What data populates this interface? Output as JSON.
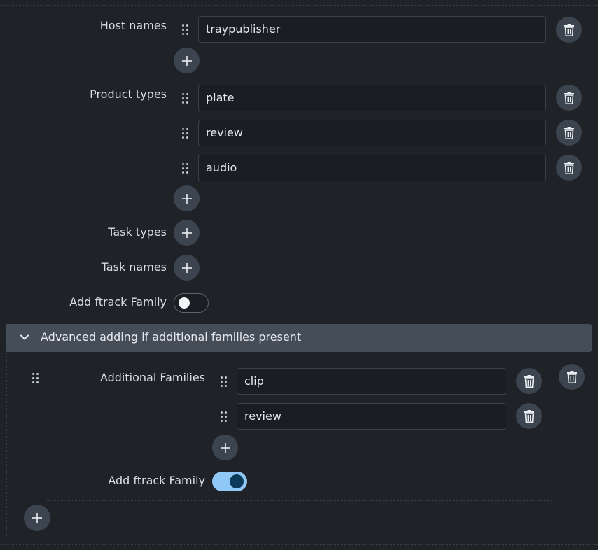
{
  "host_names": {
    "label": "Host names",
    "items": [
      "traypublisher"
    ]
  },
  "product_types": {
    "label": "Product types",
    "items": [
      "plate",
      "review",
      "audio"
    ]
  },
  "task_types": {
    "label": "Task types"
  },
  "task_names": {
    "label": "Task names"
  },
  "add_ftrack_family": {
    "label": "Add ftrack Family",
    "checked": false
  },
  "advanced": {
    "title": "Advanced adding if additional families present",
    "entry": {
      "additional_families": {
        "label": "Additional Families",
        "items": [
          "clip",
          "review"
        ]
      },
      "add_ftrack_family": {
        "label": "Add ftrack Family",
        "checked": true
      }
    }
  },
  "icons": {
    "drag": "drag-handle-icon",
    "delete": "trash-icon",
    "add": "plus-icon",
    "collapse": "chevron-down-icon"
  },
  "colors": {
    "background": "#1f2226",
    "button": "#3c4450",
    "panel_header": "#454d59",
    "toggle_on": "#8fc8f7"
  }
}
